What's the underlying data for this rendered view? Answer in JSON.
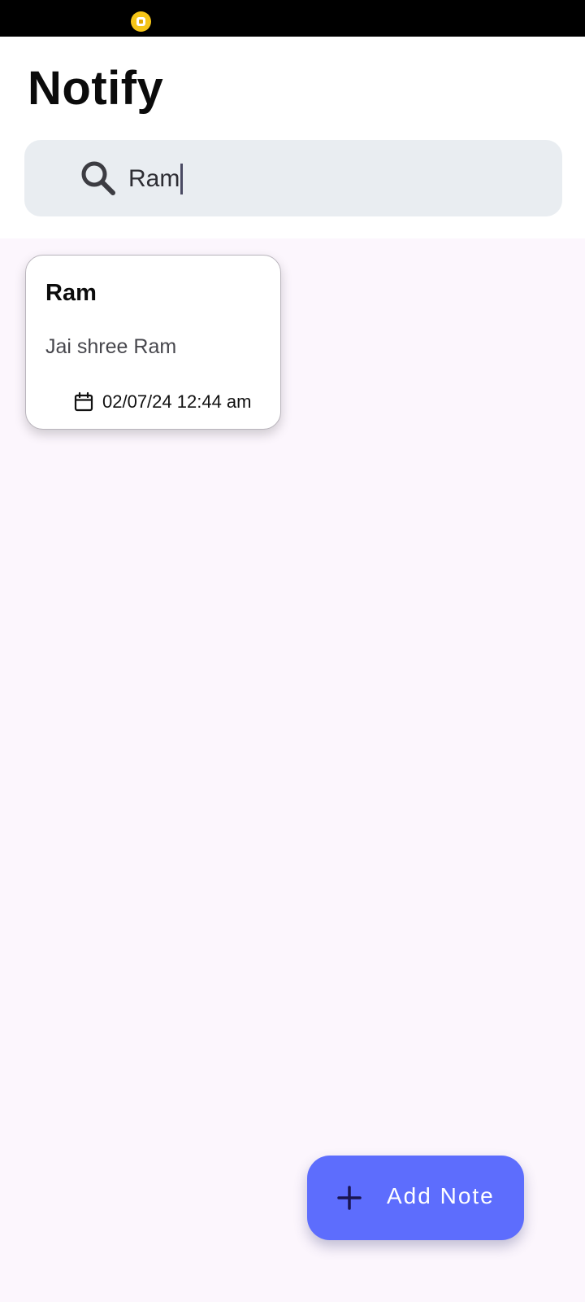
{
  "app": {
    "title": "Notify"
  },
  "search": {
    "value": "Ram",
    "placeholder": ""
  },
  "notes": [
    {
      "title": "Ram",
      "body": "Jai shree Ram",
      "date": "02/07/24 12:44 am"
    }
  ],
  "fab": {
    "label": "Add Note"
  },
  "icons": {
    "search": "search-icon",
    "calendar": "calendar-icon",
    "plus": "plus-icon",
    "status": "notification-icon"
  },
  "colors": {
    "accent": "#5d6dfd",
    "background": "#fcf6fd",
    "search_bg": "#e9edf1"
  }
}
